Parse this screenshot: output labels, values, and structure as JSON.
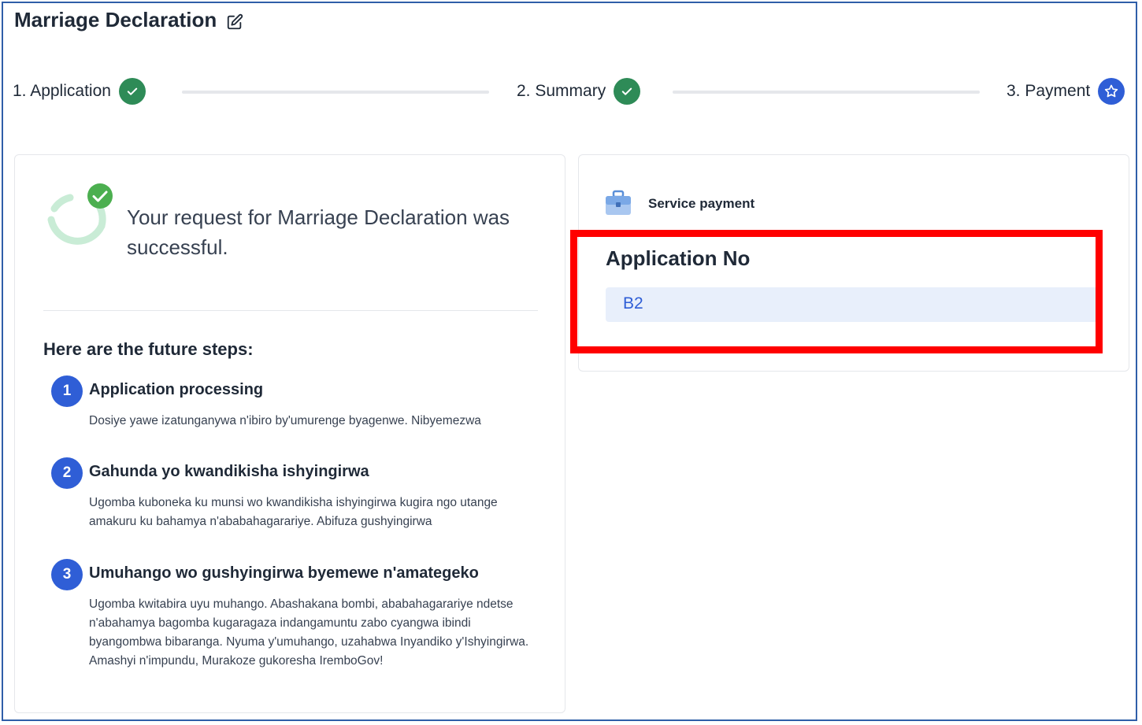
{
  "header": {
    "title": "Marriage Declaration"
  },
  "stepper": {
    "steps": [
      {
        "label": "1. Application",
        "state": "done"
      },
      {
        "label": "2. Summary",
        "state": "done"
      },
      {
        "label": "3. Payment",
        "state": "current"
      }
    ]
  },
  "success": {
    "message": "Your request for Marriage Declaration was successful."
  },
  "future_steps": {
    "title": "Here are the future steps:",
    "items": [
      {
        "number": "1",
        "title": "Application processing",
        "description": "Dosiye yawe izatunganywa n'ibiro by'umurenge byagenwe. Nibyemezwa"
      },
      {
        "number": "2",
        "title": "Gahunda yo kwandikisha ishyingirwa",
        "description": "Ugomba kuboneka ku munsi wo kwandikisha ishyingirwa kugira ngo utange amakuru ku bahamya n'ababahagarariye. Abifuza gushyingirwa"
      },
      {
        "number": "3",
        "title": "Umuhango wo gushyingirwa byemewe n'amategeko",
        "description": "Ugomba kwitabira uyu muhango. Abashakana bombi, ababahagarariye ndetse n'abahamya bagomba kugaragaza indangamuntu zabo cyangwa ibindi byangombwa bibaranga. Nyuma y'umuhango, uzahabwa Inyandiko y'Ishyingirwa. Amashyi n'impundu, Murakoze gukoresha IremboGov!"
      }
    ]
  },
  "payment": {
    "service_label": "Service payment",
    "application_no_label": "Application No",
    "application_no_value": "B2"
  },
  "colors": {
    "done": "#2e8b57",
    "current": "#2f5ed6",
    "highlight": "#ff0000",
    "frame": "#2f5ea8"
  },
  "icons": {
    "edit": "edit-icon",
    "check": "check-icon",
    "star": "star-icon",
    "success": "success-check-icon",
    "briefcase": "briefcase-icon"
  }
}
